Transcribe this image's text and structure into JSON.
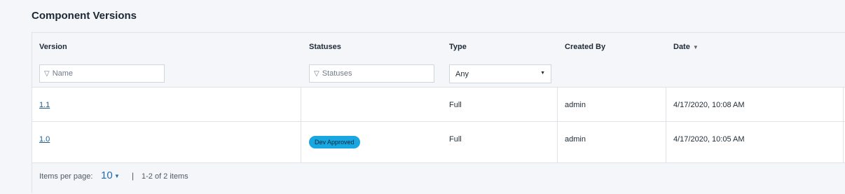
{
  "title": "Component Versions",
  "columns": {
    "version": "Version",
    "statuses": "Statuses",
    "type": "Type",
    "created_by": "Created By",
    "date": "Date"
  },
  "filters": {
    "name_placeholder": "Name",
    "statuses_placeholder": "Statuses",
    "type_value": "Any"
  },
  "rows": [
    {
      "version": "1.1",
      "status": "",
      "type": "Full",
      "created_by": "admin",
      "date": "4/17/2020, 10:08 AM"
    },
    {
      "version": "1.0",
      "status": "Dev Approved",
      "type": "Full",
      "created_by": "admin",
      "date": "4/17/2020, 10:05 AM"
    }
  ],
  "footer": {
    "items_per_page_label": "Items per page:",
    "items_per_page_value": "10",
    "separator": "|",
    "count": "1-2 of 2 items"
  },
  "colors": {
    "badge": "#18a7e0",
    "link": "#1f5e8f",
    "accent": "#1f6fb2"
  }
}
